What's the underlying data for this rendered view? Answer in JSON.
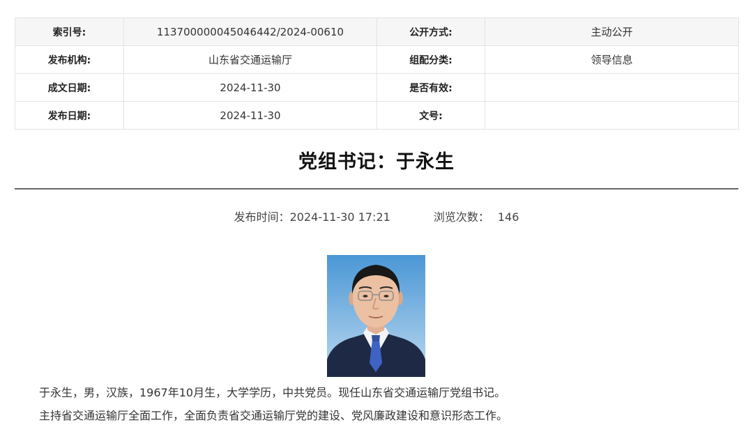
{
  "meta": {
    "index_no_label": "索引号:",
    "index_no": "113700000045046442/2024-00610",
    "disclosure_label": "公开方式:",
    "disclosure": "主动公开",
    "publisher_label": "发布机构:",
    "publisher": "山东省交通运输厅",
    "category_label": "组配分类:",
    "category": "领导信息",
    "written_date_label": "成文日期:",
    "written_date": "2024-11-30",
    "valid_label": "是否有效:",
    "valid": "",
    "publish_date_label": "发布日期:",
    "publish_date": "2024-11-30",
    "doc_no_label": "文号:",
    "doc_no": ""
  },
  "article": {
    "title": "党组书记：于永生",
    "publish_time_label": "发布时间：",
    "publish_time": "2024-11-30 17:21",
    "views_label": "浏览次数：",
    "views": "146",
    "bio_line1": "于永生，男，汉族，1967年10月生，大学学历，中共党员。现任山东省交通运输厅党组书记。",
    "bio_line2": "主持省交通运输厅全面工作，全面负责省交通运输厅党的建设、党风廉政建设和意识形态工作。"
  },
  "colors": {
    "photo_bg_top": "#4a97d6",
    "photo_bg_bottom": "#bcd9ef",
    "suit": "#1e2a45",
    "tie": "#3f63c4"
  }
}
